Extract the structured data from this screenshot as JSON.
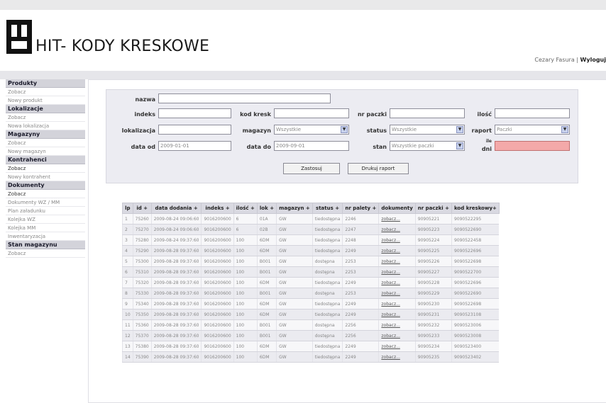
{
  "brand": {
    "title": "HIT- KODY KRESKOWE"
  },
  "user": {
    "name": "Cezary Fasura |",
    "logout": "Wyloguj"
  },
  "sidebar": [
    {
      "header": "Produkty",
      "items": [
        "Zobacz",
        "Nowy produkt"
      ]
    },
    {
      "header": "Lokalizacje",
      "items": [
        "Zobacz",
        "Nowa lokalizacja"
      ]
    },
    {
      "header": "Magazyny",
      "items": [
        "Zobacz",
        "Nowy magazyn"
      ]
    },
    {
      "header": "Kontrahenci",
      "items": [
        "Zobacz",
        "Nowy kontrahent"
      ]
    },
    {
      "header": "Dokumenty",
      "items": [
        "Zobacz",
        "Dokumenty WZ / MM",
        "Plan załadunku",
        "Kolejka WZ",
        "Kolejka MM",
        "Inwentaryzacja"
      ]
    },
    {
      "header": "Stan magazynu",
      "items": [
        "Zobacz"
      ]
    }
  ],
  "form": {
    "nazwa_label": "nazwa",
    "indeks_label": "indeks",
    "kod_label": "kod kresk",
    "nr_paczki_label": "nr paczki",
    "ilosc_label": "ilość",
    "lokalizacja_label": "lokalizacja",
    "magazyn_label": "magazyn",
    "magazyn_value": "Wszystkie",
    "status_label": "status",
    "status_value": "Wszystkie",
    "raport_label": "raport",
    "raport_value": "Paczki",
    "data_od_label": "data od",
    "data_od_value": "2009-01-01",
    "data_do_label": "data do",
    "data_do_value": "2009-09-01",
    "stan_label": "stan",
    "stan_value": "Wszystkie paczki",
    "dni_label_1": "ile",
    "dni_label_2": "dni",
    "search_button": "Zastosuj",
    "print_button": "Drukuj raport"
  },
  "table": {
    "headers": [
      "lp",
      "id +",
      "data dodania +",
      "indeks +",
      "ilość +",
      "lok +",
      "magazyn +",
      "status +",
      "nr palety +",
      "dokumenty",
      "nr paczki +",
      "kod kreskowy+"
    ],
    "rows": [
      [
        "1",
        "75260",
        "2009-08-24 09:06:60",
        "9016200600",
        "6",
        "01A",
        "GW",
        "tiedostępna",
        "2246",
        "zobacz...",
        "90905221",
        "9090522295"
      ],
      [
        "2",
        "75270",
        "2009-08-24 09:06:60",
        "9016200600",
        "6",
        "02B",
        "GW",
        "tiedostępna",
        "2247",
        "zobacz...",
        "90905223",
        "9090522690"
      ],
      [
        "3",
        "75280",
        "2009-08-24 09:37:60",
        "9016200600",
        "100",
        "6DM",
        "GW",
        "tiedostępna",
        "2248",
        "zobacz...",
        "90905224",
        "9090522458"
      ],
      [
        "4",
        "75290",
        "2009-08-28 09:37:60",
        "9016200600",
        "100",
        "6DM",
        "GW",
        "tiedostępna",
        "2249",
        "zobacz...",
        "90905225",
        "9090522696"
      ],
      [
        "5",
        "75300",
        "2009-08-28 09:37:60",
        "9016200600",
        "100",
        "B001",
        "GW",
        "dostępna",
        "2253",
        "zobacz...",
        "90905226",
        "9090522698"
      ],
      [
        "6",
        "75310",
        "2009-08-28 09:37:60",
        "9016200600",
        "100",
        "B001",
        "GW",
        "dostępna",
        "2253",
        "zobacz...",
        "90905227",
        "9090522700"
      ],
      [
        "7",
        "75320",
        "2009-08-28 09:37:60",
        "9016200600",
        "100",
        "6DM",
        "GW",
        "tiedostępna",
        "2249",
        "zobacz...",
        "90905228",
        "9090522696"
      ],
      [
        "8",
        "75330",
        "2009-08-28 09:37:60",
        "9016200600",
        "100",
        "B001",
        "GW",
        "dostępna",
        "2253",
        "zobacz...",
        "90905229",
        "9090522690"
      ],
      [
        "9",
        "75340",
        "2009-08-28 09:37:60",
        "9016200600",
        "100",
        "6DM",
        "GW",
        "tiedostępna",
        "2249",
        "zobacz...",
        "90905230",
        "9090522698"
      ],
      [
        "10",
        "75350",
        "2009-08-28 09:37:60",
        "9016200600",
        "100",
        "6DM",
        "GW",
        "tiedostępna",
        "2249",
        "zobacz...",
        "90905231",
        "9090523108"
      ],
      [
        "11",
        "75360",
        "2009-08-28 09:37:60",
        "9016200600",
        "100",
        "B001",
        "GW",
        "dostępna",
        "2256",
        "zobacz...",
        "90905232",
        "9090523006"
      ],
      [
        "12",
        "75370",
        "2009-08-28 09:37:60",
        "9016200600",
        "100",
        "B001",
        "GW",
        "dostępna",
        "2256",
        "zobacz...",
        "90905233",
        "9090523008"
      ],
      [
        "13",
        "75380",
        "2009-08-28 09:37:60",
        "9016200600",
        "100",
        "6DM",
        "GW",
        "tiedostępna",
        "2249",
        "zobacz...",
        "90905234",
        "9090523400"
      ],
      [
        "14",
        "75390",
        "2009-08-28 09:37:60",
        "9016200600",
        "100",
        "6DM",
        "GW",
        "tiedostępna",
        "2249",
        "zobacz...",
        "90905235",
        "9090523402"
      ]
    ]
  }
}
